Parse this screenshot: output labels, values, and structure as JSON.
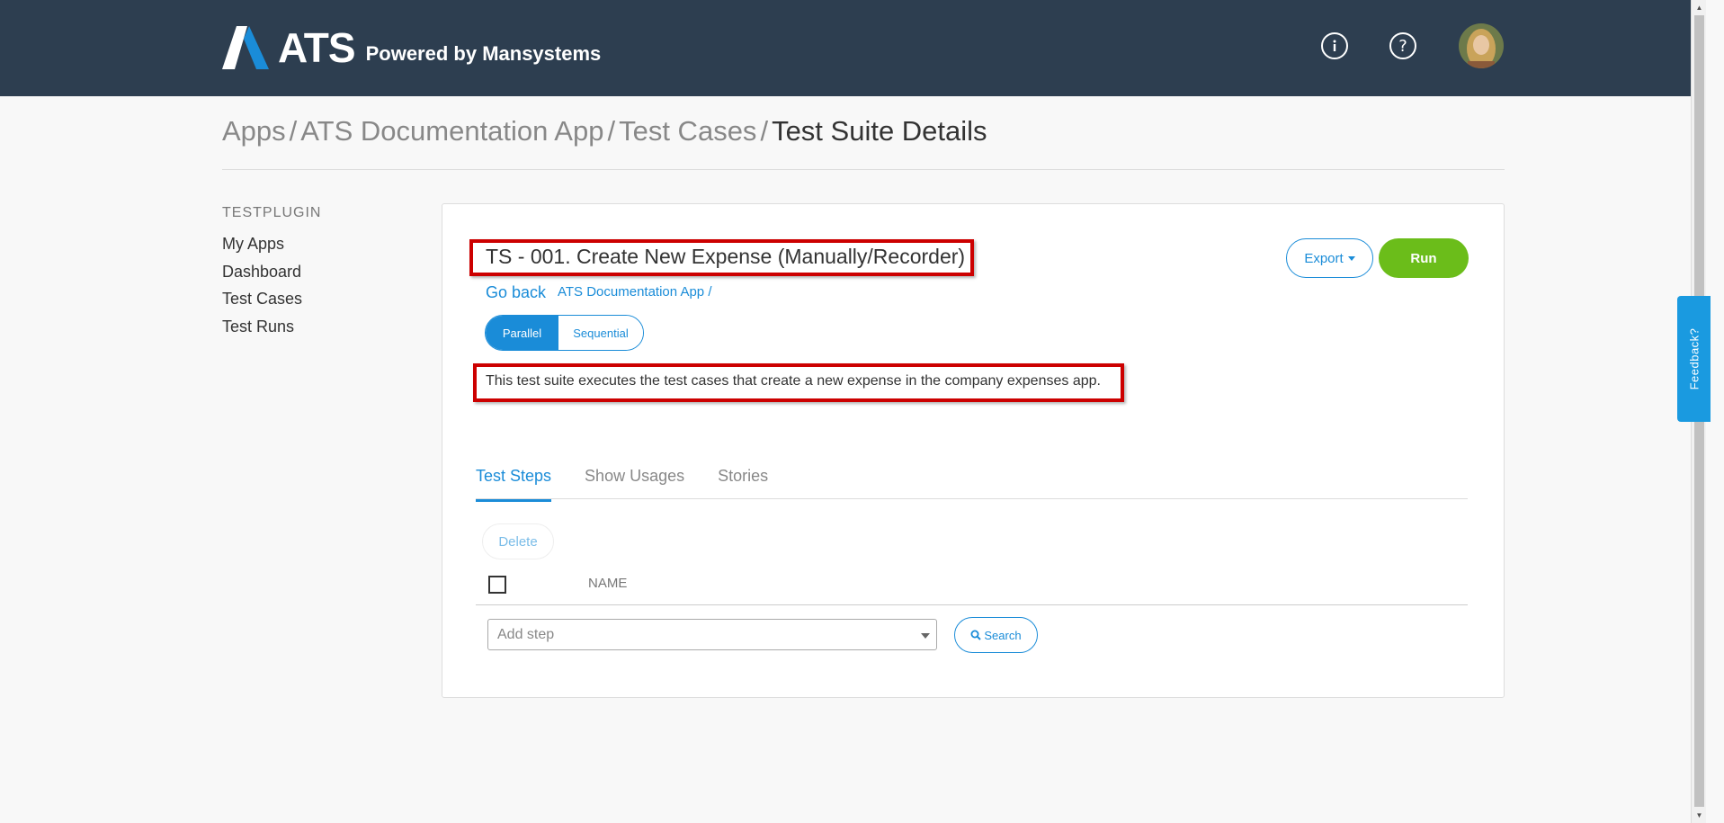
{
  "header": {
    "logo_text": "ATS",
    "powered_by": "Powered by Mansystems",
    "info_icon": "info-icon",
    "help_icon": "help-icon",
    "colors": {
      "bar": "#2d3e50",
      "logo_accent": "#1a8cd8"
    }
  },
  "breadcrumb": {
    "items": [
      "Apps",
      "ATS Documentation App",
      "Test Cases"
    ],
    "separator": "/",
    "current": "Test Suite Details"
  },
  "sidebar": {
    "title": "TESTPLUGIN",
    "items": [
      {
        "label": "My Apps"
      },
      {
        "label": "Dashboard"
      },
      {
        "label": "Test Cases"
      },
      {
        "label": "Test Runs"
      }
    ]
  },
  "suite": {
    "title": "TS - 001. Create New Expense (Manually/Recorder)",
    "go_back": "Go back",
    "app_link": "ATS Documentation App /",
    "mode_options": [
      "Parallel",
      "Sequential"
    ],
    "mode_selected": "Parallel",
    "description": "This test suite executes the test cases that create a new expense in the company expenses app."
  },
  "actions": {
    "export_label": "Export",
    "run_label": "Run",
    "colors": {
      "primary": "#1a8cd8",
      "run": "#6bbd1a",
      "highlight": "#cc0000"
    }
  },
  "tabs": [
    {
      "label": "Test Steps",
      "active": true
    },
    {
      "label": "Show Usages",
      "active": false
    },
    {
      "label": "Stories",
      "active": false
    }
  ],
  "steps": {
    "delete_label": "Delete",
    "column_name": "NAME",
    "add_step_placeholder": "Add step",
    "search_label": "Search"
  },
  "feedback": {
    "label": "Feedback?"
  }
}
